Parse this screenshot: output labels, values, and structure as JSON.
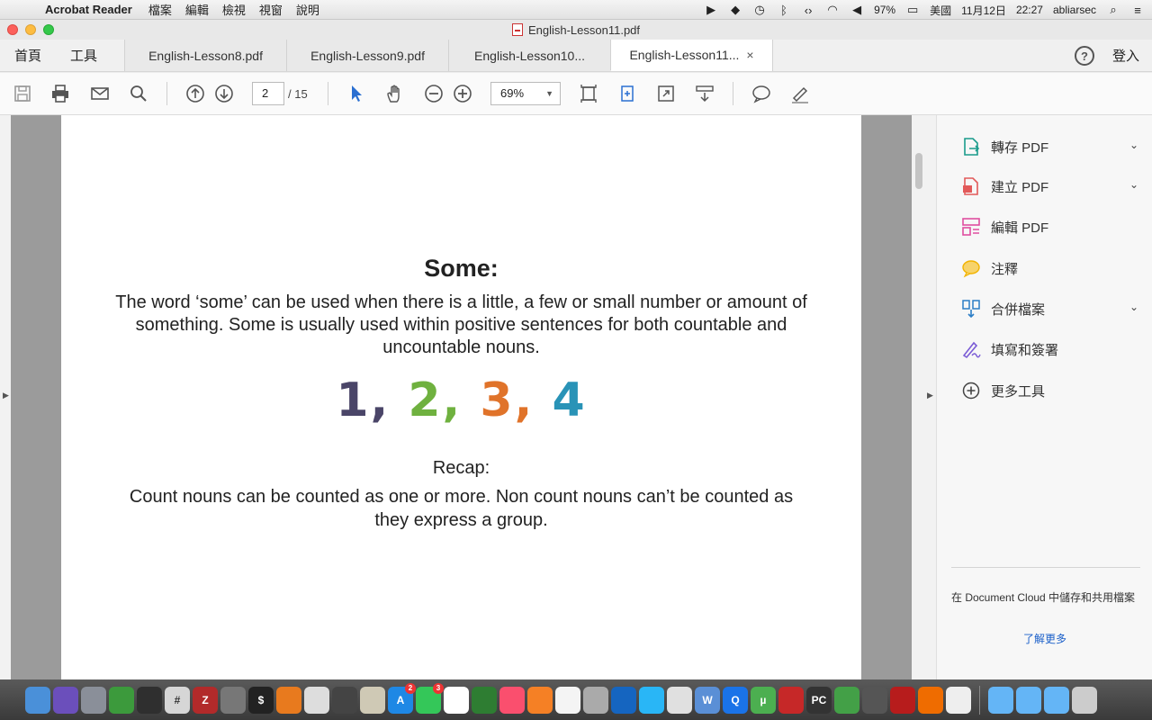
{
  "menubar": {
    "app_name": "Acrobat Reader",
    "menus": [
      "檔案",
      "編輯",
      "檢視",
      "視窗",
      "說明"
    ],
    "battery": "97%",
    "input_source": "美國",
    "date": "11月12日",
    "time": "22:27",
    "user": "abliarsec"
  },
  "window": {
    "title": "English-Lesson11.pdf"
  },
  "tabs": {
    "home": "首頁",
    "tools": "工具",
    "docs": [
      "English-Lesson8.pdf",
      "English-Lesson9.pdf",
      "English-Lesson10...",
      "English-Lesson11..."
    ],
    "close": "×",
    "help": "?",
    "login": "登入"
  },
  "toolbar": {
    "page_current": "2",
    "page_total": "/ 15",
    "zoom": "69%"
  },
  "document": {
    "title": "Some:",
    "paragraph": "The word ‘some’ can be used when there is a little, a few or small number or amount of something. Some is usually used within positive sentences for both countable and uncountable nouns.",
    "numbers": [
      "1,",
      "2,",
      "3,",
      "4"
    ],
    "recap_title": "Recap:",
    "recap_text": "Count nouns can be counted as one or more. Non count nouns can’t be counted as they express a group."
  },
  "right_panel": {
    "items": [
      {
        "label": "轉存 PDF",
        "icon": "export-pdf-icon",
        "color": "#1a9c8c"
      },
      {
        "label": "建立 PDF",
        "icon": "create-pdf-icon",
        "color": "#e25a5a"
      },
      {
        "label": "編輯 PDF",
        "icon": "edit-pdf-icon",
        "color": "#e04fa0"
      },
      {
        "label": "注釋",
        "icon": "comment-icon",
        "color": "#f2b300"
      },
      {
        "label": "合併檔案",
        "icon": "combine-files-icon",
        "color": "#2c7ec6"
      },
      {
        "label": "填寫和簽署",
        "icon": "fill-sign-icon",
        "color": "#7b5cd6"
      },
      {
        "label": "更多工具",
        "icon": "more-tools-icon",
        "color": "#444444"
      }
    ],
    "cloud_text": "在 Document Cloud 中儲存和共用檔案",
    "learn_more": "了解更多"
  },
  "dock": {
    "badges": [
      "2",
      "3"
    ]
  }
}
